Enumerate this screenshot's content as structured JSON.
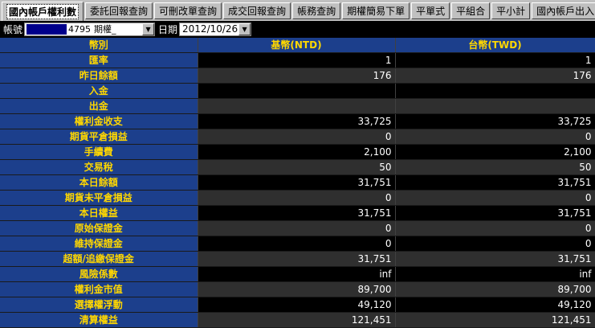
{
  "tabs": [
    {
      "label": "國內帳戶權利數",
      "active": true
    },
    {
      "label": "委託回報查詢",
      "active": false
    },
    {
      "label": "可刪改單查詢",
      "active": false
    },
    {
      "label": "成交回報查詢",
      "active": false
    },
    {
      "label": "帳務查詢",
      "active": false
    },
    {
      "label": "期權簡易下單",
      "active": false
    },
    {
      "label": "平單式",
      "active": false
    },
    {
      "label": "平組合",
      "active": false
    },
    {
      "label": "平小計",
      "active": false
    },
    {
      "label": "國內帳戶出入",
      "active": false
    }
  ],
  "toolbar": {
    "account_label": "帳號",
    "account_number": "4795",
    "account_type": "期權_",
    "date_label": "日期",
    "date_value": "2012/10/26"
  },
  "table": {
    "headers": [
      "幣別",
      "基幣(NTD)",
      "台幣(TWD)"
    ],
    "rows": [
      {
        "label": "匯率",
        "ntd": "1",
        "twd": "1"
      },
      {
        "label": "昨日餘額",
        "ntd": "176",
        "twd": "176"
      },
      {
        "label": "入金",
        "ntd": "",
        "twd": ""
      },
      {
        "label": "出金",
        "ntd": "",
        "twd": ""
      },
      {
        "label": "權利金收支",
        "ntd": "33,725",
        "twd": "33,725"
      },
      {
        "label": "期貨平倉損益",
        "ntd": "0",
        "twd": "0"
      },
      {
        "label": "手續費",
        "ntd": "2,100",
        "twd": "2,100"
      },
      {
        "label": "交易稅",
        "ntd": "50",
        "twd": "50"
      },
      {
        "label": "本日餘額",
        "ntd": "31,751",
        "twd": "31,751"
      },
      {
        "label": "期貨未平倉損益",
        "ntd": "0",
        "twd": "0"
      },
      {
        "label": "本日權益",
        "ntd": "31,751",
        "twd": "31,751"
      },
      {
        "label": "原始保證金",
        "ntd": "0",
        "twd": "0"
      },
      {
        "label": "維持保證金",
        "ntd": "0",
        "twd": "0"
      },
      {
        "label": "超額/追繳保證金",
        "ntd": "31,751",
        "twd": "31,751"
      },
      {
        "label": "風險係數",
        "ntd": "inf",
        "twd": "inf"
      },
      {
        "label": "權利金市值",
        "ntd": "89,700",
        "twd": "89,700"
      },
      {
        "label": "選擇權浮動",
        "ntd": "49,120",
        "twd": "49,120"
      },
      {
        "label": "清算權益",
        "ntd": "121,451",
        "twd": "121,451"
      }
    ]
  }
}
